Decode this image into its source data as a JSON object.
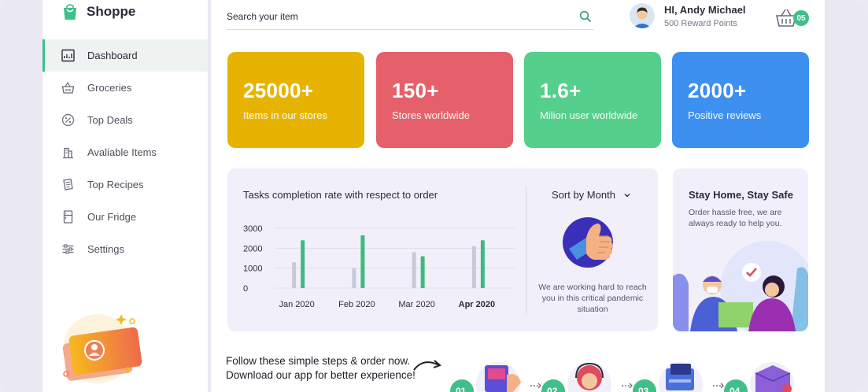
{
  "brand": {
    "name": "Shoppe",
    "accent": "#3fbf8a"
  },
  "sidebar": {
    "items": [
      {
        "label": "Dashboard",
        "icon": "dashboard-icon",
        "active": true
      },
      {
        "label": "Groceries",
        "icon": "basket-icon",
        "active": false
      },
      {
        "label": "Top Deals",
        "icon": "discount-icon",
        "active": false
      },
      {
        "label": "Avaliable Items",
        "icon": "items-icon",
        "active": false
      },
      {
        "label": "Top Recipes",
        "icon": "recipe-icon",
        "active": false
      },
      {
        "label": "Our Fridge",
        "icon": "fridge-icon",
        "active": false
      },
      {
        "label": "Settings",
        "icon": "settings-icon",
        "active": false
      }
    ]
  },
  "search": {
    "placeholder": "Search your item"
  },
  "user": {
    "greeting": "HI, Andy Michael",
    "points": "500 Reward Points"
  },
  "cart": {
    "count": "05"
  },
  "stats": [
    {
      "value": "25000+",
      "label": "Items in our stores",
      "color": "#e6b400"
    },
    {
      "value": "150+",
      "label": "Stores worldwide",
      "color": "#e5606a"
    },
    {
      "value": "1.6+",
      "label": "Milion user worldwide",
      "color": "#55cf8c"
    },
    {
      "value": "2000+",
      "label": "Positive reviews",
      "color": "#3d8ff0"
    }
  ],
  "chart_data": {
    "type": "bar",
    "title": "Tasks completion rate with respect to order",
    "categories": [
      "Jan 2020",
      "Feb 2020",
      "Mar 2020",
      "Apr 2020"
    ],
    "series": [
      {
        "values": [
          1300,
          1000,
          1800,
          2100
        ],
        "color": "#c9c8d6"
      },
      {
        "values": [
          2400,
          2650,
          1600,
          2400
        ],
        "color": "#3dba80"
      }
    ],
    "yticks": [
      "3000",
      "2000",
      "1000",
      "0"
    ],
    "ylim": [
      0,
      3000
    ],
    "grid": true
  },
  "sort": {
    "label": "Sort by Month"
  },
  "chart_note": "We are working hard to reach you in this critical pandemic situation",
  "safe": {
    "title": "Stay Home, Stay Safe",
    "text": "Order hassle free, we are always ready to help you."
  },
  "steps": {
    "line1": "Follow these simple steps & order now.",
    "line2": "Download our app for better experience!",
    "numbers": [
      "01",
      "02",
      "03",
      "04"
    ]
  }
}
